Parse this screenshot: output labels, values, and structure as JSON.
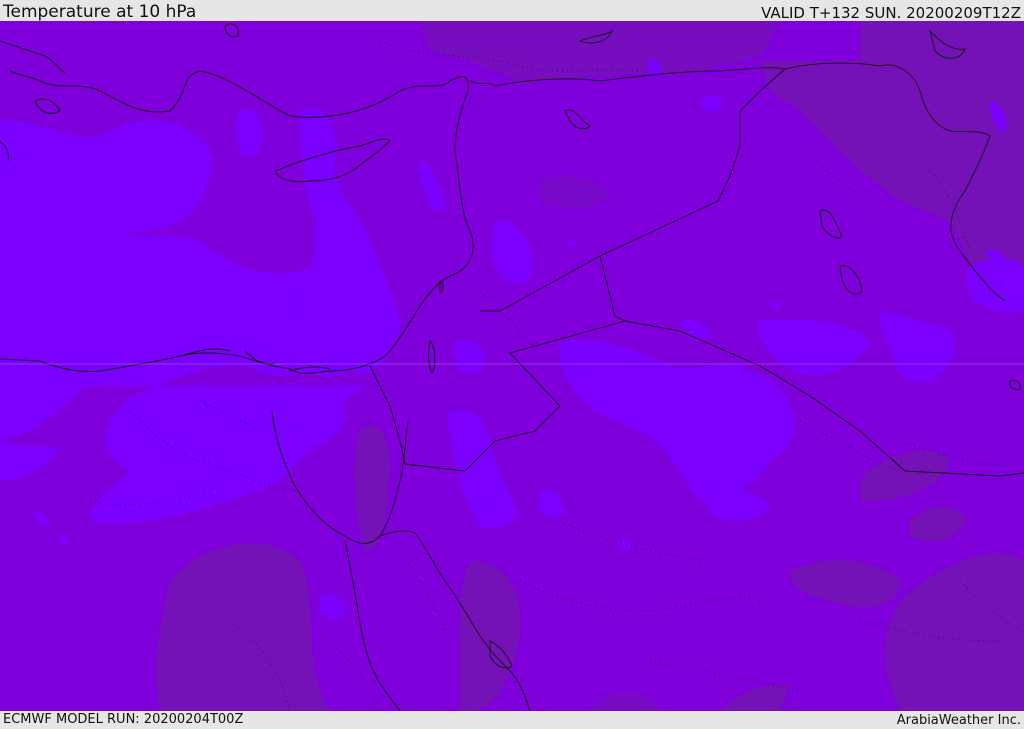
{
  "header": {
    "title": "Temperature at 10 hPa",
    "valid_time": "VALID T+132 SUN. 20200209T12Z"
  },
  "footer": {
    "model_run": "ECMWF MODEL RUN: 20200204T00Z",
    "credit": "ArabiaWeather Inc."
  },
  "map": {
    "colors": {
      "base_fill": "#7f00dc",
      "warmer_fill": "#7b00ff",
      "colder_fill": "#7412b8",
      "border_line": "#1a1a1a",
      "contour_line": "#3a0a6a"
    }
  }
}
